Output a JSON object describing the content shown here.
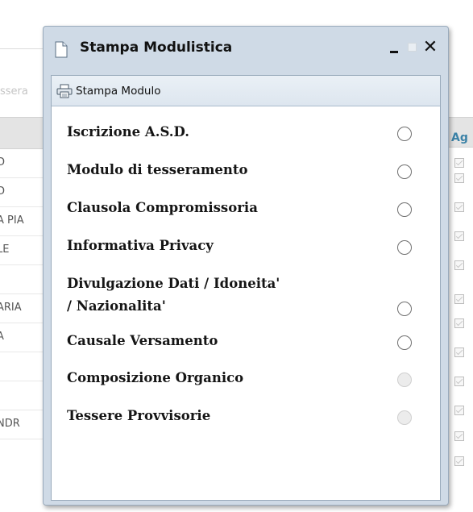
{
  "background": {
    "search_placeholder": "ssera",
    "left_rows": [
      "D",
      "A PIA",
      "LE",
      "",
      "ARIA",
      "A",
      "",
      "",
      "NDR"
    ],
    "right_header": "Ag",
    "checks_count_label": ""
  },
  "window": {
    "title": "Stampa Modulistica",
    "title_icon": "document-icon",
    "controls": {
      "minimize": "_",
      "maximize": "□",
      "close": "✕"
    },
    "toolbar": {
      "print_label": "Stampa Modulo",
      "print_icon": "printer-icon"
    },
    "items": [
      {
        "label": "Iscrizione A.S.D.",
        "enabled": true
      },
      {
        "label": "Modulo di tesseramento",
        "enabled": true
      },
      {
        "label": "Clausola Compromissoria",
        "enabled": true
      },
      {
        "label": "Informativa Privacy",
        "enabled": true
      },
      {
        "label_line1": "Divulgazione Dati / Idoneita'",
        "label_line2": "/ Nazionalita'",
        "enabled": true
      },
      {
        "label": "Causale Versamento",
        "enabled": true
      },
      {
        "label": "Composizione Organico",
        "enabled": false
      },
      {
        "label": "Tessere Provvisorie",
        "enabled": false
      }
    ]
  },
  "colors": {
    "window_frame": "#cfdae6",
    "toolbar": "#e3eaf2",
    "disabled_radio": "#ececec",
    "header_accent": "#3b82a7"
  }
}
